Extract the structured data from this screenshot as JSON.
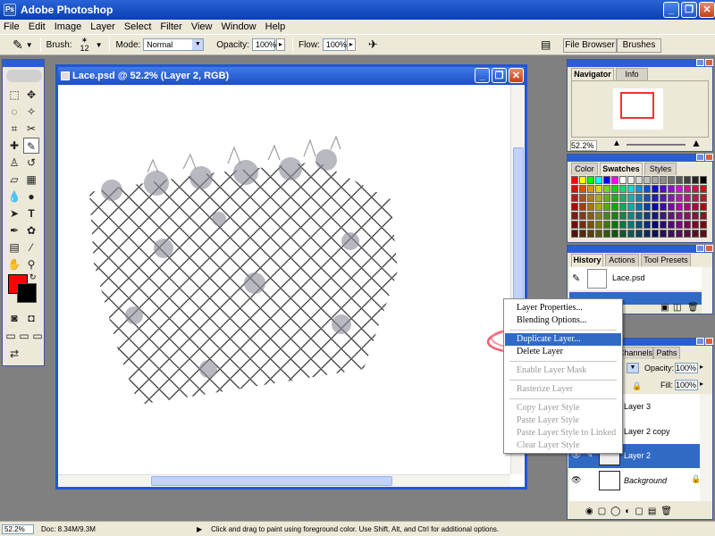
{
  "app": {
    "title": "Adobe Photoshop"
  },
  "menu": [
    "File",
    "Edit",
    "Image",
    "Layer",
    "Select",
    "Filter",
    "View",
    "Window",
    "Help"
  ],
  "options": {
    "brush_label": "Brush:",
    "brush_size": "12",
    "mode_label": "Mode:",
    "mode_value": "Normal",
    "opacity_label": "Opacity:",
    "opacity_value": "100%",
    "flow_label": "Flow:",
    "flow_value": "100%",
    "file_browser": "File Browser",
    "brushes": "Brushes"
  },
  "document": {
    "title": "Lace.psd @ 52.2% (Layer 2, RGB)"
  },
  "navigator": {
    "tabs": [
      "Navigator",
      "Info"
    ],
    "zoom": "52.2%"
  },
  "color_panel": {
    "tabs": [
      "Color",
      "Swatches",
      "Styles"
    ]
  },
  "history": {
    "tabs": [
      "History",
      "Actions",
      "Tool Presets"
    ],
    "snapshot": "Lace.psd"
  },
  "layers": {
    "tabs": [
      "Channels",
      "Paths"
    ],
    "opacity_label": "Opacity:",
    "opacity_value": "100%",
    "fill_label": "Fill:",
    "fill_value": "100%",
    "items": [
      "Layer 3",
      "Layer 2 copy",
      "Layer 2",
      "Background"
    ]
  },
  "context_menu": {
    "items": [
      {
        "label": "Layer Properties...",
        "enabled": true
      },
      {
        "label": "Blending Options...",
        "enabled": true
      },
      {
        "label": "Duplicate Layer...",
        "enabled": true,
        "highlighted": true
      },
      {
        "label": "Delete Layer",
        "enabled": true
      },
      {
        "label": "Enable Layer Mask",
        "enabled": false
      },
      {
        "label": "Rasterize Layer",
        "enabled": false
      },
      {
        "label": "Copy Layer Style",
        "enabled": false
      },
      {
        "label": "Paste Layer Style",
        "enabled": false
      },
      {
        "label": "Paste Layer Style to Linked",
        "enabled": false
      },
      {
        "label": "Clear Layer Style",
        "enabled": false
      }
    ]
  },
  "status": {
    "zoom": "52.2%",
    "doc": "Doc: 8.34M/9.3M",
    "hint": "Click and drag to paint using foreground color.  Use Shift, Alt, and Ctrl for additional options."
  },
  "colors": {
    "foreground": "#ff0000",
    "background": "#000000",
    "highlight": "#316ac5",
    "xp_blue": "#2357d0"
  }
}
